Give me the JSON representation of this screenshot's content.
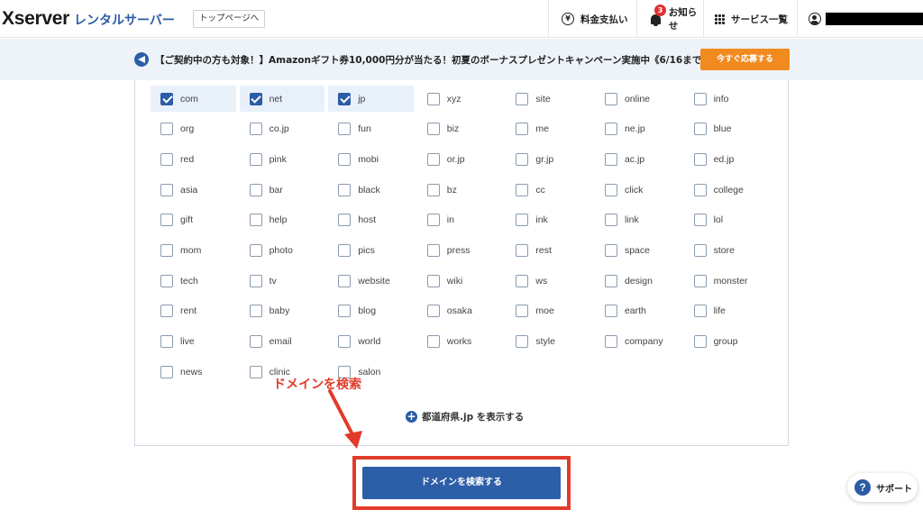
{
  "header": {
    "logo_brand": "Xserver",
    "logo_product": "レンタルサーバー",
    "top_link": "トップページへ",
    "nav": {
      "billing": "料金支払い",
      "notice": "お知らせ",
      "notice_badge": "3",
      "services": "サービス一覧"
    }
  },
  "banner": {
    "text": "【ご契約中の方も対象！】Amazonギフト券10,000円分が当たる！初夏のボーナスプレゼントキャンペーン実施中《6/16まで》",
    "button": "今すぐ応募する"
  },
  "tlds": [
    {
      "label": "com",
      "checked": true
    },
    {
      "label": "net",
      "checked": true
    },
    {
      "label": "jp",
      "checked": true
    },
    {
      "label": "xyz",
      "checked": false
    },
    {
      "label": "site",
      "checked": false
    },
    {
      "label": "online",
      "checked": false
    },
    {
      "label": "info",
      "checked": false
    },
    {
      "label": "org",
      "checked": false
    },
    {
      "label": "co.jp",
      "checked": false
    },
    {
      "label": "fun",
      "checked": false
    },
    {
      "label": "biz",
      "checked": false
    },
    {
      "label": "me",
      "checked": false
    },
    {
      "label": "ne.jp",
      "checked": false
    },
    {
      "label": "blue",
      "checked": false
    },
    {
      "label": "red",
      "checked": false
    },
    {
      "label": "pink",
      "checked": false
    },
    {
      "label": "mobi",
      "checked": false
    },
    {
      "label": "or.jp",
      "checked": false
    },
    {
      "label": "gr.jp",
      "checked": false
    },
    {
      "label": "ac.jp",
      "checked": false
    },
    {
      "label": "ed.jp",
      "checked": false
    },
    {
      "label": "asia",
      "checked": false
    },
    {
      "label": "bar",
      "checked": false
    },
    {
      "label": "black",
      "checked": false
    },
    {
      "label": "bz",
      "checked": false
    },
    {
      "label": "cc",
      "checked": false
    },
    {
      "label": "click",
      "checked": false
    },
    {
      "label": "college",
      "checked": false
    },
    {
      "label": "gift",
      "checked": false
    },
    {
      "label": "help",
      "checked": false
    },
    {
      "label": "host",
      "checked": false
    },
    {
      "label": "in",
      "checked": false
    },
    {
      "label": "ink",
      "checked": false
    },
    {
      "label": "link",
      "checked": false
    },
    {
      "label": "lol",
      "checked": false
    },
    {
      "label": "mom",
      "checked": false
    },
    {
      "label": "photo",
      "checked": false
    },
    {
      "label": "pics",
      "checked": false
    },
    {
      "label": "press",
      "checked": false
    },
    {
      "label": "rest",
      "checked": false
    },
    {
      "label": "space",
      "checked": false
    },
    {
      "label": "store",
      "checked": false
    },
    {
      "label": "tech",
      "checked": false
    },
    {
      "label": "tv",
      "checked": false
    },
    {
      "label": "website",
      "checked": false
    },
    {
      "label": "wiki",
      "checked": false
    },
    {
      "label": "ws",
      "checked": false
    },
    {
      "label": "design",
      "checked": false
    },
    {
      "label": "monster",
      "checked": false
    },
    {
      "label": "rent",
      "checked": false
    },
    {
      "label": "baby",
      "checked": false
    },
    {
      "label": "blog",
      "checked": false
    },
    {
      "label": "osaka",
      "checked": false
    },
    {
      "label": "moe",
      "checked": false
    },
    {
      "label": "earth",
      "checked": false
    },
    {
      "label": "life",
      "checked": false
    },
    {
      "label": "live",
      "checked": false
    },
    {
      "label": "email",
      "checked": false
    },
    {
      "label": "world",
      "checked": false
    },
    {
      "label": "works",
      "checked": false
    },
    {
      "label": "style",
      "checked": false
    },
    {
      "label": "company",
      "checked": false
    },
    {
      "label": "group",
      "checked": false
    },
    {
      "label": "news",
      "checked": false
    },
    {
      "label": "clinic",
      "checked": false
    },
    {
      "label": "salon",
      "checked": false
    }
  ],
  "prefecture_link": "都道府県.jp を表示する",
  "annotation": "ドメインを検索",
  "search_button": "ドメインを検索する",
  "support_button": "サポート",
  "colors": {
    "brand_blue": "#2b5ca5",
    "orange": "#f18a1f",
    "annotation_red": "#e23b2a",
    "banner_bg": "#eef3f9"
  },
  "icons": {
    "billing": "yen-icon",
    "notice": "bell-icon",
    "services": "grid-icon",
    "account": "user-icon",
    "banner": "megaphone-icon",
    "prefecture": "plus-circle-icon",
    "support": "question-icon"
  }
}
